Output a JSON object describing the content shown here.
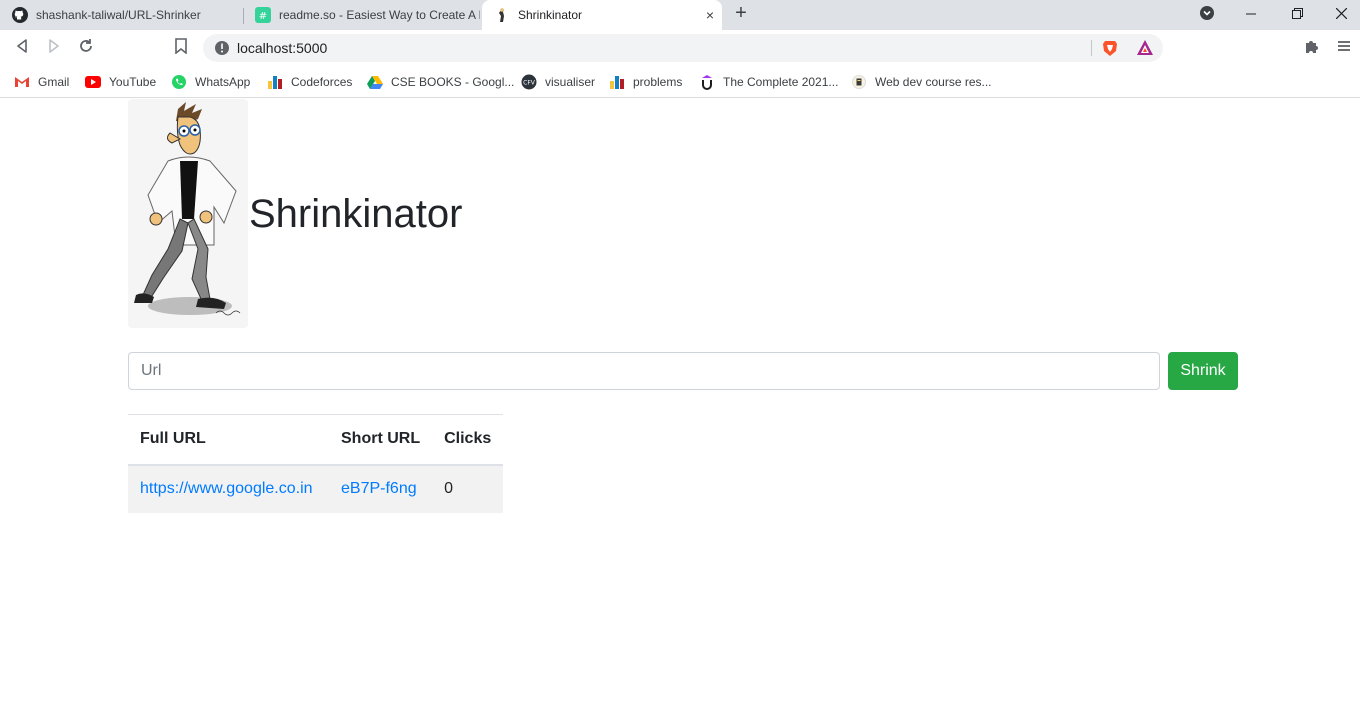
{
  "browser": {
    "tabs": [
      {
        "title": "shashank-taliwal/URL-Shrinker",
        "icon": "github-icon"
      },
      {
        "title": "readme.so - Easiest Way to Create A R",
        "icon": "readme-icon"
      },
      {
        "title": "Shrinkinator",
        "icon": "doofenshmirtz-icon",
        "active": true
      }
    ],
    "new_tab_symbol": "+",
    "close_symbol": "×",
    "address": "localhost:5000",
    "bookmarks": [
      {
        "label": "Gmail",
        "icon": "gmail-icon"
      },
      {
        "label": "YouTube",
        "icon": "youtube-icon"
      },
      {
        "label": "WhatsApp",
        "icon": "whatsapp-icon"
      },
      {
        "label": "Codeforces",
        "icon": "codeforces-icon"
      },
      {
        "label": "CSE BOOKS - Googl...",
        "icon": "google-drive-icon"
      },
      {
        "label": "visualiser",
        "icon": "visualiser-icon"
      },
      {
        "label": "problems",
        "icon": "bar-chart-icon"
      },
      {
        "label": "The Complete 2021...",
        "icon": "udemy-icon"
      },
      {
        "label": "Web dev course res...",
        "icon": "notion-icon"
      }
    ]
  },
  "page": {
    "title": "Shrinkinator",
    "form": {
      "placeholder": "Url",
      "value": "",
      "button": "Shrink"
    },
    "table": {
      "headers": [
        "Full URL",
        "Short URL",
        "Clicks"
      ],
      "rows": [
        {
          "full": "https://www.google.co.in",
          "short": "eB7P-f6ng",
          "clicks": "0"
        }
      ]
    }
  },
  "colors": {
    "accent_green": "#28a745",
    "link_blue": "#007bff"
  }
}
